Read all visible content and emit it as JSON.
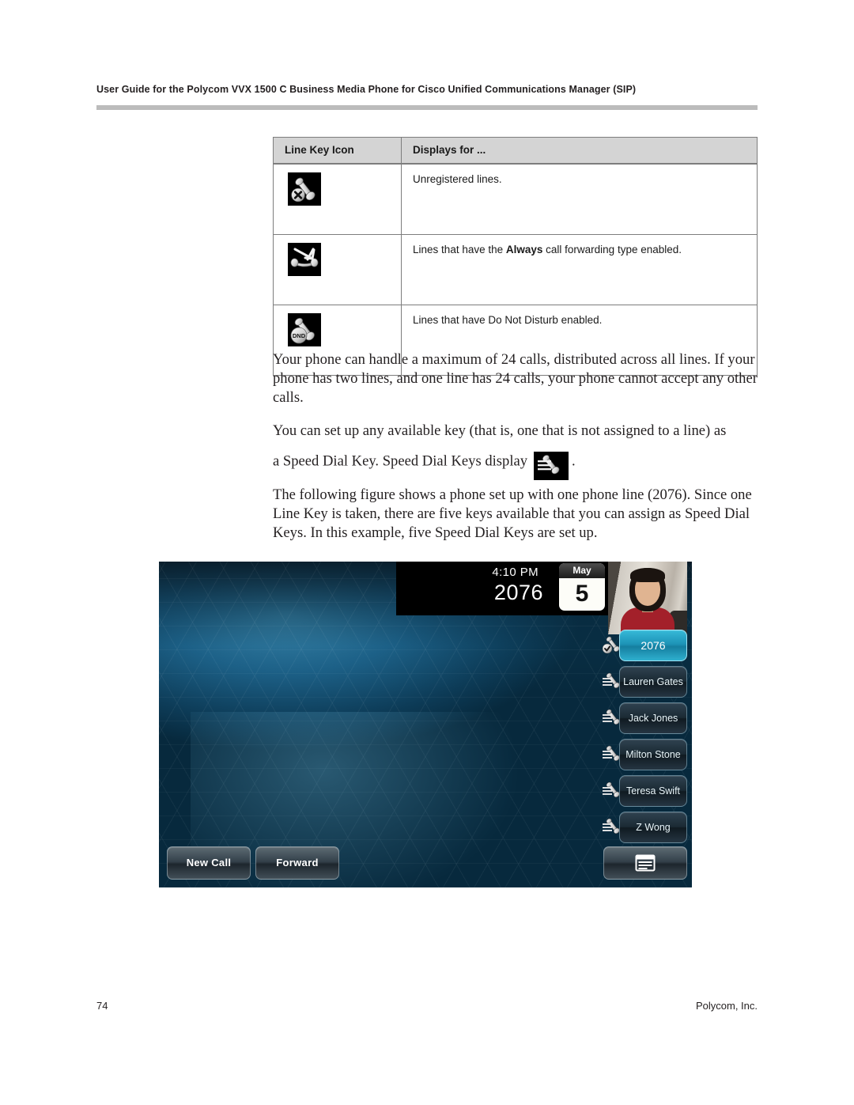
{
  "header": {
    "running_head": "User Guide for the Polycom VVX 1500 C Business Media Phone for Cisco Unified Communications Manager (SIP)"
  },
  "table": {
    "columns": [
      "Line Key Icon",
      "Displays for ..."
    ],
    "rows": [
      {
        "icon": "unregistered-line-icon",
        "desc_prefix": "Unregistered lines.",
        "desc_bold": "",
        "desc_suffix": ""
      },
      {
        "icon": "call-forward-always-icon",
        "desc_prefix": "Lines that have the ",
        "desc_bold": "Always",
        "desc_suffix": " call forwarding type enabled."
      },
      {
        "icon": "do-not-disturb-icon",
        "desc_prefix": "Lines that have Do Not Disturb enabled.",
        "desc_bold": "",
        "desc_suffix": ""
      }
    ]
  },
  "body": {
    "para1": "Your phone can handle a maximum of 24 calls, distributed across all lines. If your phone has two lines, and one line has 24 calls, your phone cannot accept any other calls.",
    "para2": "You can set up any available key (that is, one that is not assigned to a line) as",
    "para3_before": "a Speed Dial Key. Speed Dial Keys display",
    "para3_after": ".",
    "para4": "The following figure shows a phone set up with one phone line (2076). Since one Line Key is taken, there are five keys available that you can assign as Speed Dial Keys. In this example, five Speed Dial Keys are set up."
  },
  "phone": {
    "status": {
      "time": "4:10 PM",
      "line_number": "2076",
      "calendar_month": "May",
      "calendar_day": "5"
    },
    "keys": [
      {
        "label": "2076",
        "active": true
      },
      {
        "label": "Lauren Gates",
        "active": false
      },
      {
        "label": "Jack Jones",
        "active": false
      },
      {
        "label": "Milton Stone",
        "active": false
      },
      {
        "label": "Teresa Swift",
        "active": false
      },
      {
        "label": "Z Wong",
        "active": false
      }
    ],
    "softkeys": {
      "new_call": "New Call",
      "forward": "Forward",
      "menu_icon": "window-list-icon"
    }
  },
  "footer": {
    "page_number": "74",
    "company": "Polycom, Inc."
  },
  "colors": {
    "accent_cyan": "#1d93b6",
    "table_header_bg": "#d4d4d4",
    "rule_gray": "#bcbcbc",
    "text": "#231f20"
  }
}
